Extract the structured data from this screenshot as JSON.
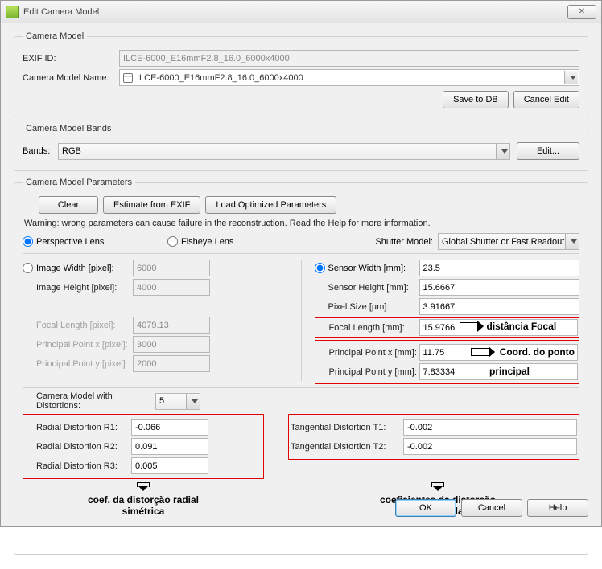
{
  "window": {
    "title": "Edit Camera Model",
    "close": "✕"
  },
  "camera_model": {
    "legend": "Camera Model",
    "exif_id_label": "EXIF ID:",
    "exif_id_value": "ILCE-6000_E16mmF2.8_16.0_6000x4000",
    "name_label": "Camera Model Name:",
    "name_value": "ILCE-6000_E16mmF2.8_16.0_6000x4000",
    "save_db": "Save to DB",
    "cancel_edit": "Cancel Edit"
  },
  "bands": {
    "legend": "Camera Model Bands",
    "bands_label": "Bands:",
    "bands_value": "RGB",
    "edit": "Edit..."
  },
  "params": {
    "legend": "Camera Model Parameters",
    "clear": "Clear",
    "estimate": "Estimate from EXIF",
    "load_opt": "Load Optimized Parameters",
    "warning": "Warning: wrong parameters can cause failure in the reconstruction. Read the Help for more information.",
    "lens_perspective": "Perspective Lens",
    "lens_fisheye": "Fisheye Lens",
    "shutter_label": "Shutter Model:",
    "shutter_value": "Global Shutter or Fast Readout",
    "pixel": {
      "img_w_label": "Image Width [pixel]:",
      "img_w_value": "6000",
      "img_h_label": "Image Height [pixel]:",
      "img_h_value": "4000",
      "focal_label": "Focal Length [pixel]:",
      "focal_value": "4079.13",
      "ppx_label": "Principal Point x [pixel]:",
      "ppx_value": "3000",
      "ppy_label": "Principal Point y [pixel]:",
      "ppy_value": "2000"
    },
    "mm": {
      "sensor_w_label": "Sensor Width [mm]:",
      "sensor_w_value": "23.5",
      "sensor_h_label": "Sensor Height [mm]:",
      "sensor_h_value": "15.6667",
      "pixel_size_label": "Pixel Size [µm]:",
      "pixel_size_value": "3.91667",
      "focal_label": "Focal Length [mm]:",
      "focal_value": "15.9766",
      "ppx_label": "Principal Point x [mm]:",
      "ppx_value": "11.75",
      "ppy_label": "Principal Point y [mm]:",
      "ppy_value": "7.83334"
    },
    "distortion": {
      "order_label": "Camera Model with Distortions:",
      "order_value": "5",
      "r1_label": "Radial Distortion R1:",
      "r1_value": "-0.066",
      "r2_label": "Radial Distortion R2:",
      "r2_value": "0.091",
      "r3_label": "Radial Distortion R3:",
      "r3_value": "0.005",
      "t1_label": "Tangential Distortion T1:",
      "t1_value": "-0.002",
      "t2_label": "Tangential Distortion T2:",
      "t2_value": "-0.002"
    }
  },
  "annotations": {
    "focal": "distância Focal",
    "principal1": "Coord. do ponto",
    "principal2": "principal",
    "radial1": "coef. da distorção radial",
    "radial2": "simétrica",
    "tangential1": "coeficientes da distorção",
    "tangential2": "descetrada"
  },
  "buttons": {
    "ok": "OK",
    "cancel": "Cancel",
    "help": "Help"
  }
}
